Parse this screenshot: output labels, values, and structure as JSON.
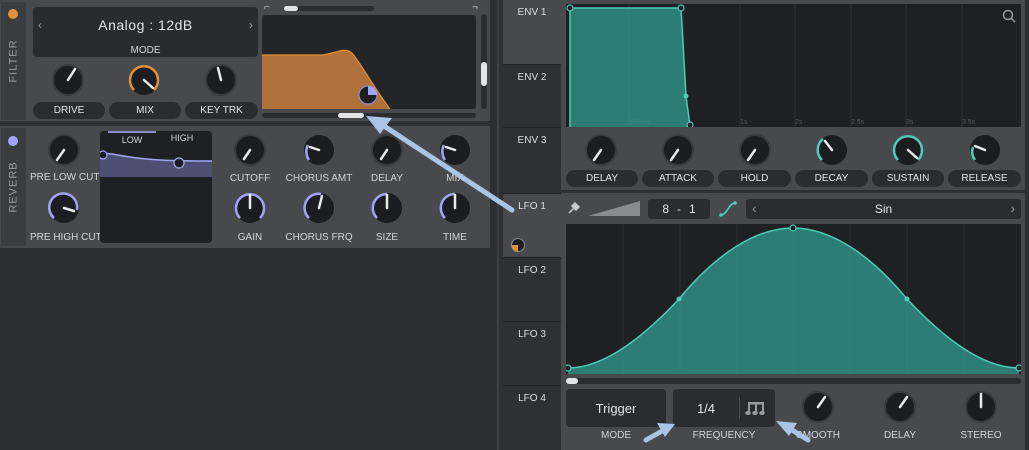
{
  "filter": {
    "tab_label": "FILTER",
    "mode_value": "Analog : 12dB",
    "mode_label": "MODE",
    "knobs": [
      {
        "label": "DRIVE",
        "value": 0.62
      },
      {
        "label": "MIX",
        "value": 1.0
      },
      {
        "label": "KEY TRK",
        "value": 0.45
      }
    ],
    "slope_left_icon": "low-slope-icon",
    "slope_right_icon": "high-slope-icon"
  },
  "reverb": {
    "tab_label": "REVERB",
    "eq_tabs": [
      "LOW",
      "HIGH"
    ],
    "knobs": [
      {
        "label": "PRE LOW CUT",
        "value": 0.6
      },
      {
        "label": "PRE HIGH CUT",
        "value": 0.7
      },
      {
        "label": "CUTOFF",
        "value": 0.6
      },
      {
        "label": "CHORUS AMT",
        "value": 0.3
      },
      {
        "label": "DELAY",
        "value": 0.5
      },
      {
        "label": "MIX",
        "value": 0.3
      },
      {
        "label": "GAIN",
        "value": 0.5
      },
      {
        "label": "CHORUS FRQ",
        "value": 0.55
      },
      {
        "label": "SIZE",
        "value": 0.5
      },
      {
        "label": "TIME",
        "value": 0.5
      }
    ]
  },
  "envelope": {
    "tabs": [
      "ENV 1",
      "ENV 2",
      "ENV 3"
    ],
    "time_ticks": [
      "500ms",
      "1s",
      "1.5s",
      "2s",
      "2.5s",
      "3s",
      "3.5s"
    ],
    "knobs": [
      {
        "label": "DELAY",
        "value": 0.55
      },
      {
        "label": "ATTACK",
        "value": 0.55
      },
      {
        "label": "HOLD",
        "value": 0.55
      },
      {
        "label": "DECAY",
        "value": 0.38
      },
      {
        "label": "SUSTAIN",
        "value": 1.0
      },
      {
        "label": "RELEASE",
        "value": 0.32
      }
    ]
  },
  "lfo": {
    "tabs": [
      "LFO 1",
      "LFO 2",
      "LFO 3",
      "LFO 4"
    ],
    "grid_x": "8",
    "grid_sep": "-",
    "grid_y": "1",
    "shape": "Sin",
    "mode_value": "Trigger",
    "mode_label": "MODE",
    "frequency_value": "1/4",
    "frequency_label": "FREQUENCY",
    "knobs": [
      {
        "label": "SMOOTH",
        "value": 0.62
      },
      {
        "label": "DELAY",
        "value": 0.62
      },
      {
        "label": "STEREO",
        "value": 0.5
      }
    ]
  },
  "colors": {
    "accent": "#35a89a",
    "filter": "#e0913a",
    "reverb": "#a1a5f6",
    "knob_arc": "#e9e9ea",
    "arrow": "#a9c4e6"
  }
}
